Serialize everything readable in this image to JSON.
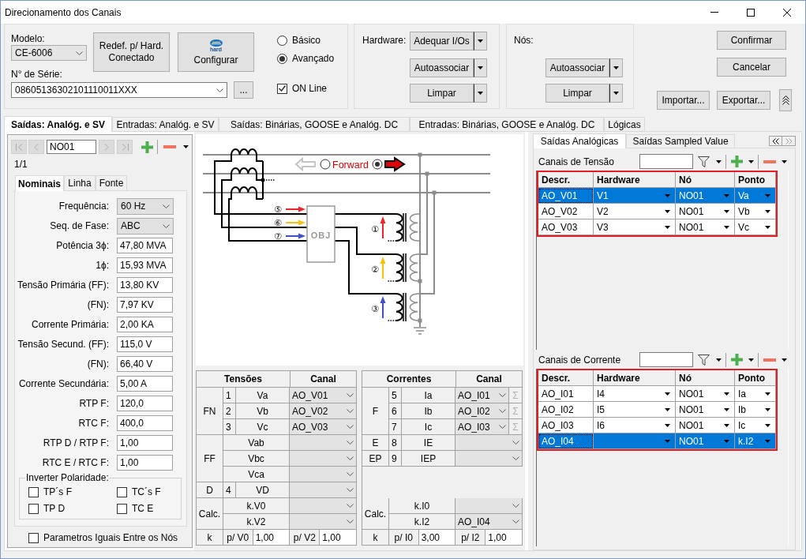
{
  "window": {
    "title": "Direcionamento dos Canais"
  },
  "device": {
    "model_label": "Modelo:",
    "model": "CE-6006",
    "reset": "Redef. p/ Hard. Conectado",
    "configure": {
      "logo": "hard",
      "label": "Configurar"
    },
    "modes": [
      {
        "label": "Básico",
        "selected": false
      },
      {
        "label": "Avançado",
        "selected": true
      }
    ],
    "serial_label": "N° de Série:",
    "serial": "08605136302101110011XXX",
    "browse": "...",
    "online": {
      "label": "ON Line",
      "checked": true
    }
  },
  "hardware": {
    "label": "Hardware:",
    "buttons": [
      "Adequar I/Os",
      "Autoassociar",
      "Limpar"
    ]
  },
  "nodes": {
    "label": "Nós:",
    "buttons": [
      "Autoassociar",
      "Limpar"
    ]
  },
  "actions": {
    "confirm": "Confirmar",
    "cancel": "Cancelar",
    "import": "Importar...",
    "export": "Exportar..."
  },
  "tabs": [
    {
      "label": "Saídas: Analóg. e SV",
      "selected": true
    },
    {
      "label": "Entradas: Analóg. e SV",
      "selected": false
    },
    {
      "label": "Saídas: Binárias, GOOSE e Analóg. DC",
      "selected": false
    },
    {
      "label": "Entradas: Binárias, GOOSE e Analóg. DC",
      "selected": false
    },
    {
      "label": "Lógicas",
      "selected": false
    }
  ],
  "node_nav": {
    "node": "NO01",
    "position": "1/1"
  },
  "settings_tabs": [
    {
      "label": "Nominais",
      "selected": true
    },
    {
      "label": "Linha",
      "selected": false
    },
    {
      "label": "Fonte",
      "selected": false
    }
  ],
  "nominals": [
    {
      "label": "Frequência:",
      "value": "60 Hz",
      "kind": "select"
    },
    {
      "label": "Seq. de Fase:",
      "value": "ABC",
      "kind": "select"
    },
    {
      "label": "Potência 3ϕ:",
      "value": "47,80 MVA",
      "kind": "text"
    },
    {
      "label": "1ϕ:",
      "value": "15,93 MVA",
      "kind": "text"
    },
    {
      "label": "Tensão Primária (FF):",
      "value": "13,80 KV",
      "kind": "text"
    },
    {
      "label": "(FN):",
      "value": "7,97 KV",
      "kind": "text"
    },
    {
      "label": "Corrente Primária:",
      "value": "2,00 KA",
      "kind": "text"
    },
    {
      "label": "Tensão Secund. (FF):",
      "value": "115,0 V",
      "kind": "text"
    },
    {
      "label": "(FN):",
      "value": "66,40 V",
      "kind": "text"
    },
    {
      "label": "Corrente Secundária:",
      "value": "5,00 A",
      "kind": "text"
    },
    {
      "label": "RTP F:",
      "value": "120,0",
      "kind": "text"
    },
    {
      "label": "RTC F:",
      "value": "400,0",
      "kind": "text"
    },
    {
      "label": "RTP D / RTP F:",
      "value": "1,00",
      "kind": "text"
    },
    {
      "label": "RTC E / RTC F:",
      "value": "1,00",
      "kind": "text"
    }
  ],
  "polarity": {
    "title": "Inverter Polaridade:",
    "options": [
      {
        "label": "TP´s F",
        "checked": false
      },
      {
        "label": "TC´s F",
        "checked": false
      },
      {
        "label": "TP D",
        "checked": false
      },
      {
        "label": "TC E",
        "checked": false
      }
    ]
  },
  "same_params": {
    "label": "Parametros Iguais Entre os Nós",
    "checked": false
  },
  "diagram": {
    "direction_label": "Forward",
    "directions": [
      {
        "kind": "reverse",
        "selected": false
      },
      {
        "kind": "forward",
        "selected": true
      }
    ],
    "relay_label": "OBJ",
    "current_inputs": [
      {
        "label": "⑤",
        "color": "#e8262b"
      },
      {
        "label": "⑥",
        "color": "#f5c211"
      },
      {
        "label": "⑦",
        "color": "#3f51c8"
      }
    ],
    "voltage_inputs": [
      {
        "label": "①",
        "color": "#e8262b"
      },
      {
        "label": "②",
        "color": "#f5c211"
      },
      {
        "label": "③",
        "color": "#3f51c8"
      }
    ]
  },
  "voltage_table": {
    "title": "Tensões",
    "channel_header": "Canal",
    "groups": [
      {
        "label": "FN",
        "rows": [
          {
            "number": "1",
            "signal": "Va",
            "channel": "AO_V01"
          },
          {
            "number": "2",
            "signal": "Vb",
            "channel": "AO_V02"
          },
          {
            "number": "3",
            "signal": "Vc",
            "channel": "AO_V03"
          }
        ]
      },
      {
        "label": "FF",
        "rows": [
          {
            "signal": "Vab"
          },
          {
            "signal": "Vbc"
          },
          {
            "signal": "Vca"
          }
        ]
      },
      {
        "label": "D",
        "rows": [
          {
            "number": "4",
            "signal": "VD"
          }
        ]
      },
      {
        "label": "Calc.",
        "rows": [
          {
            "signal": "k.V0"
          },
          {
            "signal": "k.V2"
          }
        ]
      }
    ],
    "factor_label": "k",
    "factors": [
      {
        "label": "p/ V0",
        "value": "1,00"
      },
      {
        "label": "p/ V2",
        "value": "1,00"
      }
    ]
  },
  "current_table": {
    "title": "Correntes",
    "channel_header": "Canal",
    "groups": [
      {
        "label": "F",
        "rows": [
          {
            "number": "5",
            "signal": "Ia",
            "channel": "AO_I01",
            "sum": "Σ"
          },
          {
            "number": "6",
            "signal": "Ib",
            "channel": "AO_I02",
            "sum": "Σ"
          },
          {
            "number": "7",
            "signal": "Ic",
            "channel": "AO_I03",
            "sum": "Σ"
          }
        ]
      },
      {
        "label": "E",
        "rows": [
          {
            "number": "8",
            "signal": "IE"
          }
        ]
      },
      {
        "label": "EP",
        "rows": [
          {
            "number": "9",
            "signal": "IEP"
          }
        ]
      },
      {
        "label": "Calc.",
        "rows": [
          {
            "signal": "k.I0"
          },
          {
            "signal": "k.I2",
            "channel": "AO_I04"
          }
        ]
      }
    ],
    "factor_label": "k",
    "factors": [
      {
        "label": "p/ I0",
        "value": "3,00"
      },
      {
        "label": "p/ I2",
        "value": "1,00"
      }
    ]
  },
  "channel_tabs": [
    {
      "label": "Saídas Analógicas",
      "selected": true
    },
    {
      "label": "Saídas Sampled Value",
      "selected": false
    }
  ],
  "voltage_channels": {
    "title": "Canais de Tensão",
    "columns": [
      "Descr.",
      "Hardware",
      "Nó",
      "Ponto"
    ],
    "rows": [
      {
        "description": "AO_V01",
        "hardware": "V1",
        "node": "NO01",
        "point": "Va",
        "selected": true
      },
      {
        "description": "AO_V02",
        "hardware": "V2",
        "node": "NO01",
        "point": "Vb",
        "selected": false
      },
      {
        "description": "AO_V03",
        "hardware": "V3",
        "node": "NO01",
        "point": "Vc",
        "selected": false
      }
    ]
  },
  "current_channels": {
    "title": "Canais de Corrente",
    "columns": [
      "Descr.",
      "Hardware",
      "Nó",
      "Ponto"
    ],
    "rows": [
      {
        "description": "AO_I01",
        "hardware": "I4",
        "node": "NO01",
        "point": "Ia",
        "selected": false
      },
      {
        "description": "AO_I02",
        "hardware": "I5",
        "node": "NO01",
        "point": "Ib",
        "selected": false
      },
      {
        "description": "AO_I03",
        "hardware": "I6",
        "node": "NO01",
        "point": "Ic",
        "selected": false
      },
      {
        "description": "AO_I04",
        "node": "NO01",
        "point": "k.I2",
        "selected": true
      }
    ]
  }
}
